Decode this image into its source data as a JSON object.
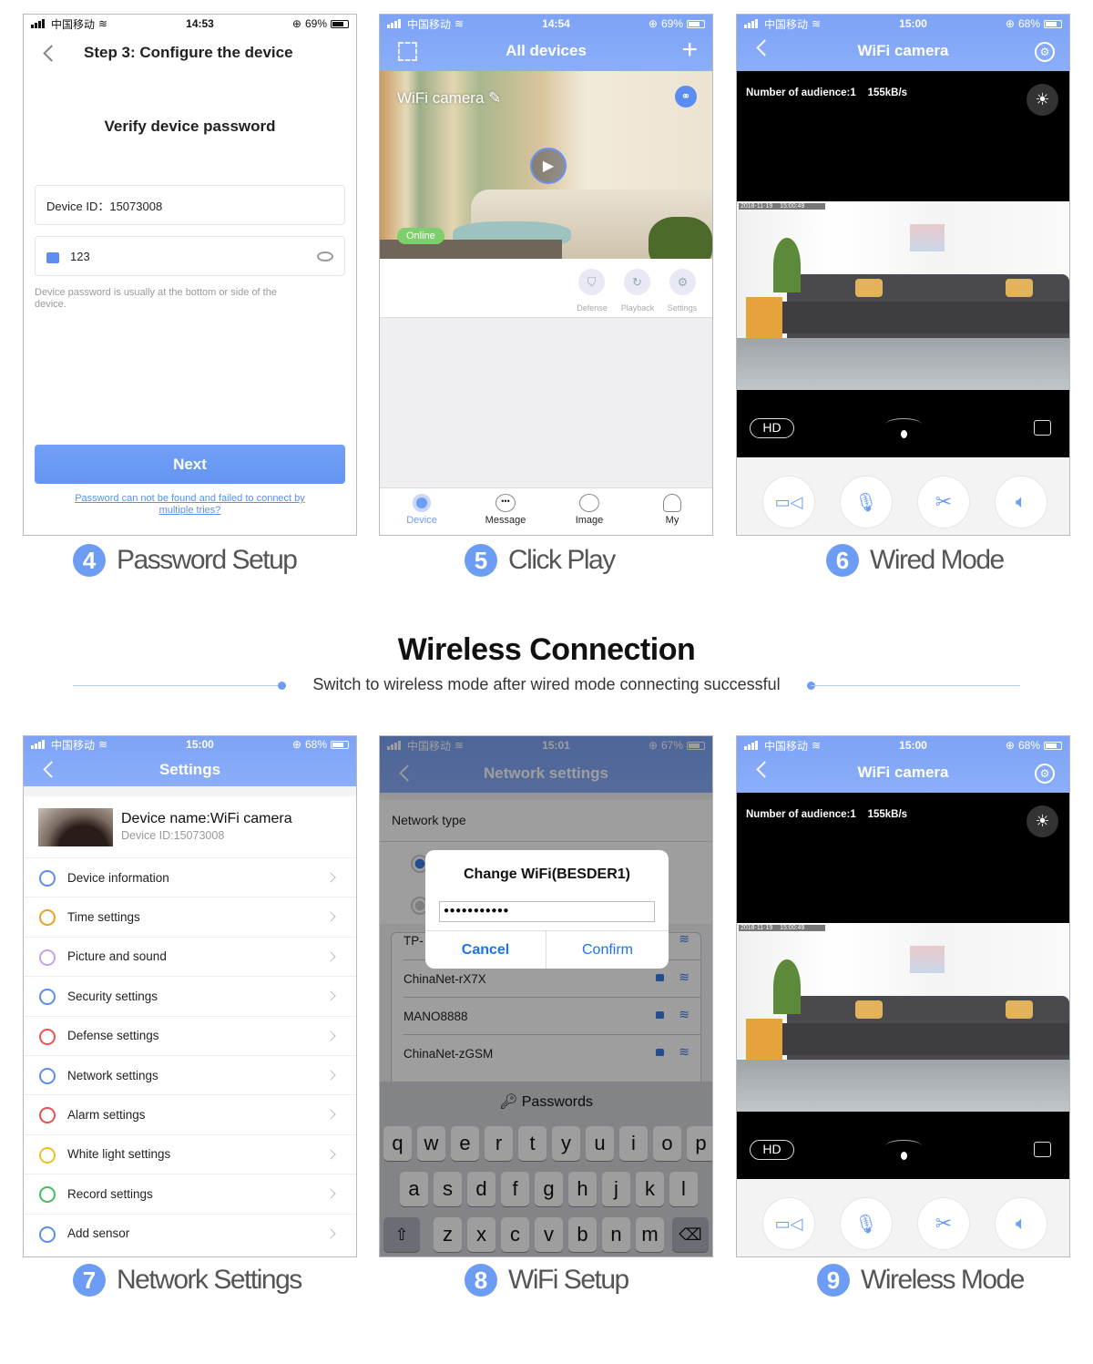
{
  "colors": {
    "accent": "#6c9cf4",
    "header": "#7ea3f6",
    "online": "#7ccf6a",
    "caption": "#555555"
  },
  "password_screen": {
    "status": {
      "carrier": "中国移动",
      "time": "14:53",
      "battery": "69%"
    },
    "title": "Step 3: Configure the device",
    "heading": "Verify device password",
    "device_id": "Device ID：15073008",
    "password_value": "123",
    "hint": "Device password is usually at the bottom or side of the device.",
    "next": "Next",
    "help_link": "Password can not be found and failed to connect by multiple tries?"
  },
  "devices_screen": {
    "status": {
      "carrier": "中国移动",
      "time": "14:54",
      "battery": "69%"
    },
    "title": "All devices",
    "camera_name": "WiFi camera",
    "online": "Online",
    "actions": [
      "Defense",
      "Playback",
      "Settings"
    ],
    "tabs": [
      "Device",
      "Message",
      "Image",
      "My"
    ]
  },
  "camera_screens": [
    {
      "status": {
        "carrier": "中国移动",
        "time": "15:00",
        "battery": "68%"
      },
      "title": "WiFi camera",
      "audience": "Number of audience:1",
      "rate": "155kB/s",
      "osd_date": "2018-11-19",
      "osd_time": "15:00:49",
      "hd": "HD"
    },
    {
      "status": {
        "carrier": "中国移动",
        "time": "15:00",
        "battery": "68%"
      },
      "title": "WiFi camera",
      "audience": "Number of audience:1",
      "rate": "155kB/s",
      "osd_date": "2018-11-19",
      "osd_time": "15:00:49",
      "hd": "HD"
    }
  ],
  "settings_screen": {
    "status": {
      "carrier": "中国移动",
      "time": "15:00",
      "battery": "68%"
    },
    "title": "Settings",
    "device_name": "Device name:WiFi camera",
    "device_id": "Device ID:15073008",
    "items": [
      {
        "label": "Device information",
        "icon": "camera-icon",
        "color": "#5b8ef0"
      },
      {
        "label": "Time settings",
        "icon": "clock-icon",
        "color": "#f0a020"
      },
      {
        "label": "Picture and sound",
        "icon": "picture-icon",
        "color": "#c9a0f0"
      },
      {
        "label": "Security settings",
        "icon": "security-icon",
        "color": "#5b8ef0"
      },
      {
        "label": "Defense settings",
        "icon": "shield-icon",
        "color": "#f05050"
      },
      {
        "label": "Network settings",
        "icon": "wifi-icon",
        "color": "#5b8ef0"
      },
      {
        "label": "Alarm settings",
        "icon": "alarm-icon",
        "color": "#f05050"
      },
      {
        "label": "White light settings",
        "icon": "bulb-icon",
        "color": "#f0c020"
      },
      {
        "label": "Record settings",
        "icon": "record-icon",
        "color": "#40c060"
      },
      {
        "label": "Add sensor",
        "icon": "sensor-icon",
        "color": "#5b8ef0"
      }
    ]
  },
  "network_screen": {
    "status": {
      "carrier": "中国移动",
      "time": "15:01",
      "battery": "67%"
    },
    "title": "Network settings",
    "network_type": "Network type",
    "dialog_title": "Change WiFi(BESDER1)",
    "password_value": "●●●●●●●●●●●",
    "cancel": "Cancel",
    "confirm": "Confirm",
    "wifi_list": [
      "TP-",
      "ChinaNet-rX7X",
      "MANO8888",
      "ChinaNet-zGSM"
    ],
    "keyboard": {
      "suggestion": "Passwords",
      "rows": [
        [
          "q",
          "w",
          "e",
          "r",
          "t",
          "y",
          "u",
          "i",
          "o",
          "p"
        ],
        [
          "a",
          "s",
          "d",
          "f",
          "g",
          "h",
          "j",
          "k",
          "l"
        ],
        [
          "z",
          "x",
          "c",
          "v",
          "b",
          "n",
          "m"
        ]
      ]
    }
  },
  "section": {
    "title": "Wireless Connection",
    "subtitle": "Switch to wireless mode after wired mode connecting successful"
  },
  "captions": [
    {
      "num": "4",
      "label": "Password Setup"
    },
    {
      "num": "5",
      "label": "Click Play"
    },
    {
      "num": "6",
      "label": "Wired Mode"
    },
    {
      "num": "7",
      "label": "Network Settings"
    },
    {
      "num": "8",
      "label": "WiFi Setup"
    },
    {
      "num": "9",
      "label": "Wireless Mode"
    }
  ]
}
